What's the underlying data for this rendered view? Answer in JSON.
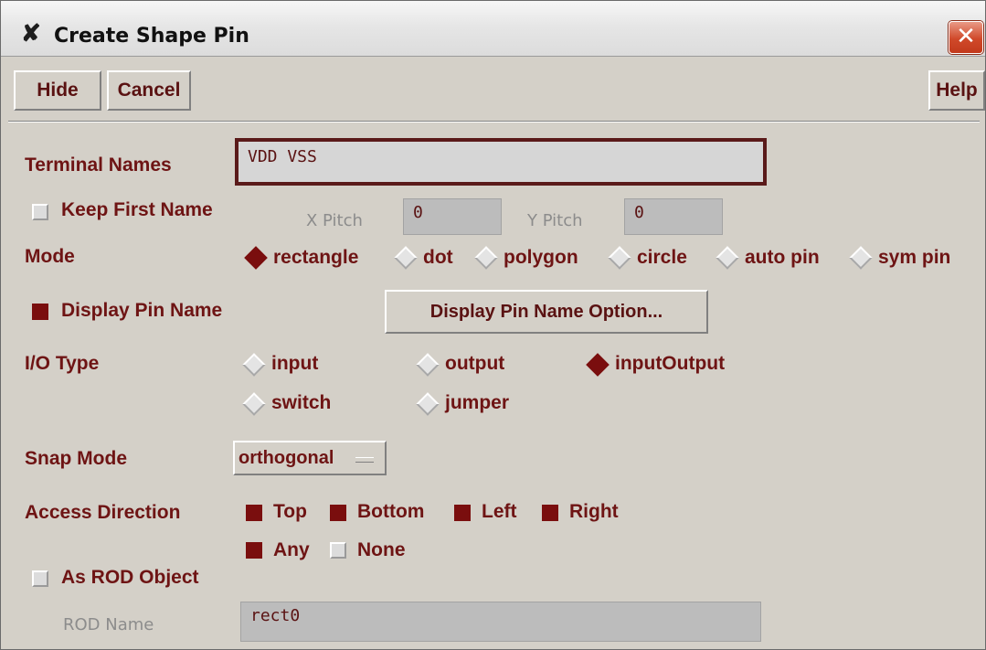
{
  "window": {
    "title": "Create Shape Pin",
    "close_glyph": "✕",
    "title_icon": "✘"
  },
  "toolbar": {
    "hide_label": "Hide",
    "cancel_label": "Cancel",
    "help_label": "Help"
  },
  "terminal_names": {
    "label": "Terminal Names",
    "value": "VDD VSS"
  },
  "keep_first_name": {
    "label": "Keep First Name",
    "checked": false
  },
  "x_pitch": {
    "label": "X Pitch",
    "value": "0"
  },
  "y_pitch": {
    "label": "Y Pitch",
    "value": "0"
  },
  "mode": {
    "label": "Mode",
    "options": [
      "rectangle",
      "dot",
      "polygon",
      "circle",
      "auto pin",
      "sym pin"
    ],
    "selected": "rectangle"
  },
  "display_pin_name": {
    "label": "Display Pin Name",
    "checked": true,
    "option_button": "Display Pin Name Option..."
  },
  "io_type": {
    "label": "I/O Type",
    "options": [
      "input",
      "output",
      "inputOutput",
      "switch",
      "jumper"
    ],
    "selected": "inputOutput"
  },
  "snap_mode": {
    "label": "Snap Mode",
    "value": "orthogonal"
  },
  "access_direction": {
    "label": "Access Direction",
    "options": [
      "Top",
      "Bottom",
      "Left",
      "Right",
      "Any",
      "None"
    ],
    "checked": [
      true,
      true,
      true,
      true,
      true,
      false
    ]
  },
  "as_rod_object": {
    "label": "As ROD Object",
    "checked": false
  },
  "rod_name": {
    "label": "ROD Name",
    "value": "rect0"
  },
  "colors": {
    "accent": "#7a0e0e",
    "label_text": "#6e1414",
    "background": "#d4d0c8"
  }
}
